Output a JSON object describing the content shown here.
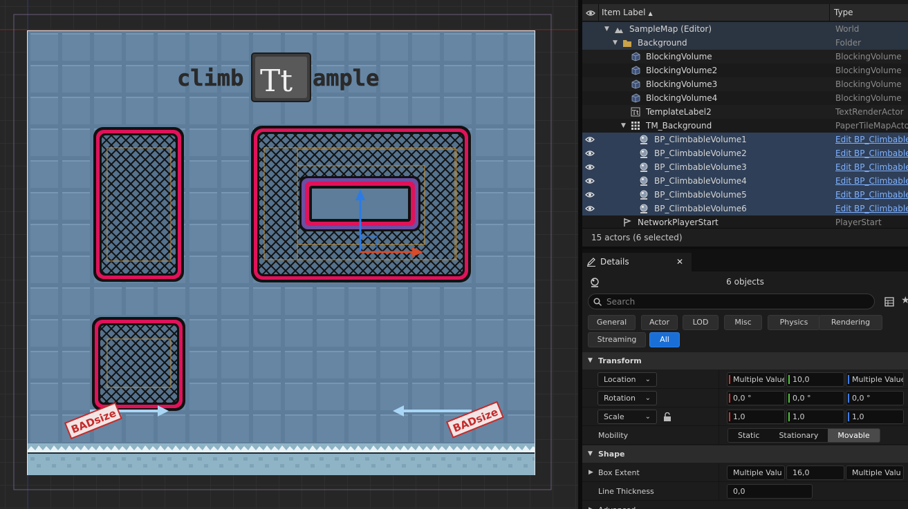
{
  "viewport": {
    "title_left": "climb",
    "title_right": "ample",
    "title_icon": "text-render-icon",
    "title_icon_glyph": "Tt",
    "bad_size_label": "BADsize",
    "colors": {
      "map_bg": "#5f7f9c",
      "grid_tile": "#6c8dab",
      "volume_border": "#e0125a",
      "selection_inner": "#6a4fa3",
      "bounds_orange": "#c39036",
      "gizmo_blue": "#2c7be5",
      "gizmo_red": "#d94b2b",
      "ground": "#9ec1d2"
    }
  },
  "outliner": {
    "header": {
      "label_col": "Item Label",
      "type_col": "Type"
    },
    "rows": [
      {
        "label": "SampleMap (Editor)",
        "type": "World",
        "icon": "world-icon",
        "depth": 0,
        "expanded": true,
        "eye": false,
        "style": "hl"
      },
      {
        "label": "Background",
        "type": "Folder",
        "icon": "folder-icon",
        "depth": 1,
        "expanded": true,
        "eye": false,
        "style": "hl"
      },
      {
        "label": "BlockingVolume",
        "type": "BlockingVolume",
        "icon": "cube-icon",
        "depth": 2,
        "eye": false,
        "style": "alt"
      },
      {
        "label": "BlockingVolume2",
        "type": "BlockingVolume",
        "icon": "cube-icon",
        "depth": 2,
        "eye": false,
        "style": ""
      },
      {
        "label": "BlockingVolume3",
        "type": "BlockingVolume",
        "icon": "cube-icon",
        "depth": 2,
        "eye": false,
        "style": "alt"
      },
      {
        "label": "BlockingVolume4",
        "type": "BlockingVolume",
        "icon": "cube-icon",
        "depth": 2,
        "eye": false,
        "style": ""
      },
      {
        "label": "TemplateLabel2",
        "type": "TextRenderActor",
        "icon": "text-render-icon",
        "depth": 2,
        "eye": false,
        "style": "alt"
      },
      {
        "label": "TM_Background",
        "type": "PaperTileMapActo",
        "icon": "tilemap-icon",
        "depth": 2,
        "expanded": true,
        "eye": false,
        "style": ""
      },
      {
        "label": "BP_ClimbableVolume1",
        "type": "Edit BP_Climbable",
        "icon": "blueprint-actor-icon",
        "depth": 3,
        "eye": true,
        "style": "sel",
        "link": true
      },
      {
        "label": "BP_ClimbableVolume2",
        "type": "Edit BP_Climbable",
        "icon": "blueprint-actor-icon",
        "depth": 3,
        "eye": true,
        "style": "sel",
        "link": true
      },
      {
        "label": "BP_ClimbableVolume3",
        "type": "Edit BP_Climbable",
        "icon": "blueprint-actor-icon",
        "depth": 3,
        "eye": true,
        "style": "sel",
        "link": true
      },
      {
        "label": "BP_ClimbableVolume4",
        "type": "Edit BP_Climbable",
        "icon": "blueprint-actor-icon",
        "depth": 3,
        "eye": true,
        "style": "sel",
        "link": true
      },
      {
        "label": "BP_ClimbableVolume5",
        "type": "Edit BP_Climbable",
        "icon": "blueprint-actor-icon",
        "depth": 3,
        "eye": true,
        "style": "sel",
        "link": true
      },
      {
        "label": "BP_ClimbableVolume6",
        "type": "Edit BP_Climbable",
        "icon": "blueprint-actor-icon",
        "depth": 3,
        "eye": true,
        "style": "sel",
        "link": true
      },
      {
        "label": "NetworkPlayerStart",
        "type": "PlayerStart",
        "icon": "player-start-icon",
        "depth": 1,
        "eye": false,
        "style": ""
      }
    ],
    "footer": "15 actors (6 selected)"
  },
  "details": {
    "tab_label": "Details",
    "objects_label": "6 objects",
    "search_placeholder": "Search",
    "filters": [
      "General",
      "Actor",
      "LOD",
      "Misc",
      "Physics",
      "Rendering",
      "Streaming",
      "All"
    ],
    "active_filter": "All",
    "transform": {
      "section": "Transform",
      "location": {
        "label": "Location",
        "x": "Multiple Value",
        "y": "10,0",
        "z": "Multiple Value"
      },
      "rotation": {
        "label": "Rotation",
        "x": "0,0 °",
        "y": "0,0 °",
        "z": "0,0 °"
      },
      "scale": {
        "label": "Scale",
        "x": "1,0",
        "y": "1,0",
        "z": "1,0"
      },
      "mobility": {
        "label": "Mobility",
        "options": [
          "Static",
          "Stationary",
          "Movable"
        ],
        "selected": "Movable"
      }
    },
    "shape": {
      "section": "Shape",
      "box_extent": {
        "label": "Box Extent",
        "x": "Multiple Valu",
        "y": "16,0",
        "z": "Multiple Valu"
      },
      "line_thickness": {
        "label": "Line Thickness",
        "value": "0,0"
      }
    },
    "advanced_label": "Advanced"
  }
}
